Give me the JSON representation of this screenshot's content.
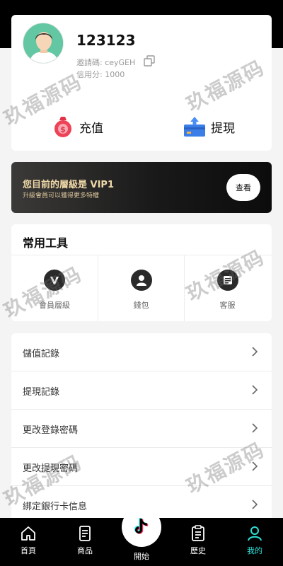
{
  "profile": {
    "username": "123123",
    "invite_code": "邀請碼: ceyGEH",
    "credit": "信用分: 1000",
    "recharge_label": "充值",
    "withdraw_label": "提現"
  },
  "vip": {
    "title": "您目前的層級是 VIP1",
    "subtitle": "升級會員可以獲得更多特權",
    "button_label": "查看"
  },
  "tools": {
    "title": "常用工具",
    "items": [
      {
        "label": "會員層級",
        "icon": "member-level-icon"
      },
      {
        "label": "錢包",
        "icon": "wallet-icon"
      },
      {
        "label": "客服",
        "icon": "customer-service-icon"
      }
    ]
  },
  "menu": {
    "items": [
      {
        "label": "儲值記錄"
      },
      {
        "label": "提現記錄"
      },
      {
        "label": "更改登錄密碼"
      },
      {
        "label": "更改提現密碼"
      },
      {
        "label": "綁定銀行卡信息"
      }
    ]
  },
  "watermark": "玖福源码",
  "tabbar": {
    "items": [
      {
        "label": "首頁",
        "icon": "home-icon"
      },
      {
        "label": "商品",
        "icon": "products-icon"
      },
      {
        "label": "開始",
        "icon": "tiktok-icon"
      },
      {
        "label": "歷史",
        "icon": "history-icon"
      },
      {
        "label": "我的",
        "icon": "profile-icon"
      }
    ],
    "active_index": 4
  },
  "colors": {
    "accent": "#2ee0d8",
    "vip_gold": "#f0d9a8",
    "background": "#f4f4f4",
    "header": "#000000"
  }
}
